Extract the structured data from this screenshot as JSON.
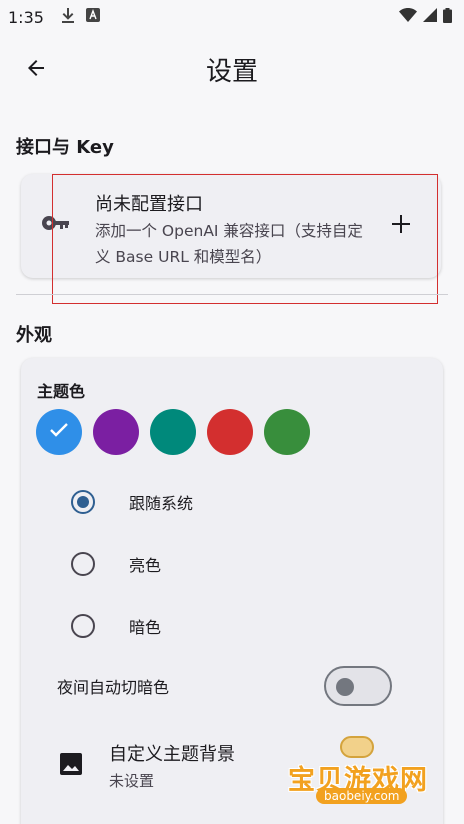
{
  "status_bar": {
    "time": "1:35",
    "download_icon": "download-icon",
    "font_icon": "font-icon",
    "wifi_icon": "wifi-icon",
    "signal_icon": "signal-icon",
    "battery_icon": "battery-icon"
  },
  "app_bar": {
    "title": "设置",
    "back_icon": "arrow-back-icon"
  },
  "api_section": {
    "title": "接口与 Key",
    "card": {
      "title": "尚未配置接口",
      "description": "添加一个 OpenAI 兼容接口（支持自定义 Base URL 和模型名）",
      "key_icon": "key-icon",
      "add_icon": "plus-icon"
    }
  },
  "appearance_section": {
    "title": "外观",
    "theme_color_label": "主题色",
    "swatches": [
      {
        "name": "blue",
        "color": "#2f8fe8",
        "selected": true
      },
      {
        "name": "purple",
        "color": "#7b1fa2",
        "selected": false
      },
      {
        "name": "teal",
        "color": "#00897b",
        "selected": false
      },
      {
        "name": "red",
        "color": "#d32f2f",
        "selected": false
      },
      {
        "name": "green",
        "color": "#388e3c",
        "selected": false
      }
    ],
    "modes": [
      {
        "label": "跟随系统",
        "selected": true
      },
      {
        "label": "亮色",
        "selected": false
      },
      {
        "label": "暗色",
        "selected": false
      }
    ],
    "night_auto_label": "夜间自动切暗色",
    "night_auto_enabled": false,
    "custom_bg": {
      "title": "自定义主题背景",
      "subtitle": "未设置",
      "icon": "image-icon"
    }
  },
  "watermark": {
    "text": "宝贝游戏网",
    "url": "baobeiy.com"
  }
}
